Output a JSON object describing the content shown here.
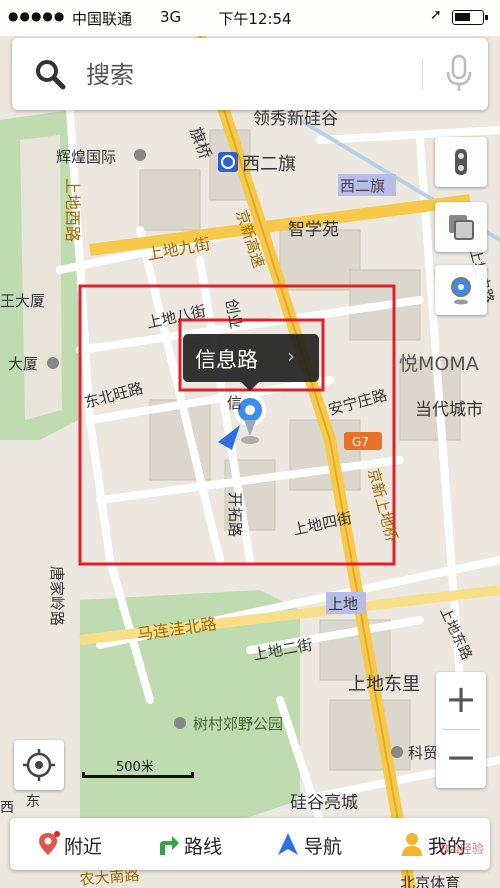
{
  "status_bar": {
    "carrier": "中国联通",
    "network": "3G",
    "time": "下午12:54"
  },
  "search": {
    "placeholder": "搜索"
  },
  "map": {
    "labels": {
      "chaoyang_n": "领秀新硅谷",
      "qijiao": "旗桥",
      "huihuang": "辉煌国际",
      "xierqi_station": "西二旗",
      "xierqi_road": "西二旗",
      "zhixueyuan": "智学苑",
      "shangdi_west": "上地西路",
      "shangdi_9": "上地九街",
      "jingxin": "京新高速",
      "wang_dasha": "王大厦",
      "dasha2": "大厦",
      "shangdi_8": "上地八街",
      "chuangye": "创业",
      "dongbeiwang": "东北旺路",
      "xinxi": "信",
      "yue_moma": "悦MOMA",
      "anning": "安宁庄路",
      "dangdai": "当代城市",
      "g7": "G7",
      "jingxin_shangdi": "京新上地桥",
      "kaituo": "开拓路",
      "shangdi_4": "上地四街",
      "tangjialing": "唐家岭路",
      "shangdi_badge": "上地",
      "malianwa": "马连洼北路",
      "shangdi_2": "上地二街",
      "shangdi_east": "上地东里",
      "shangdi_dong_road": "上地东路",
      "shucun": "树村郊野公园",
      "keji": "科贸大",
      "guigu": "硅谷亮城",
      "beijing_sports": "北京体育",
      "nong_da": "农大南路",
      "xi_left": "西",
      "dong_left": "东",
      "shangdi_zhong": "上地中路"
    }
  },
  "callout": {
    "label": "信息路"
  },
  "scale": {
    "label": "500米"
  },
  "zoom": {
    "in_label": "+",
    "out_label": "−"
  },
  "bottom_tabs": [
    {
      "label": "附近"
    },
    {
      "label": "路线"
    },
    {
      "label": "导航"
    },
    {
      "label": "我的"
    }
  ],
  "watermark": "Bai经验",
  "colors": {
    "road_major": "#f6c94a",
    "road_minor": "#ffffff",
    "park": "#bfdcb0",
    "water": "#b5d1e8",
    "highlight_box": "#e0202a",
    "metro_badge": "#2f5fd0"
  }
}
